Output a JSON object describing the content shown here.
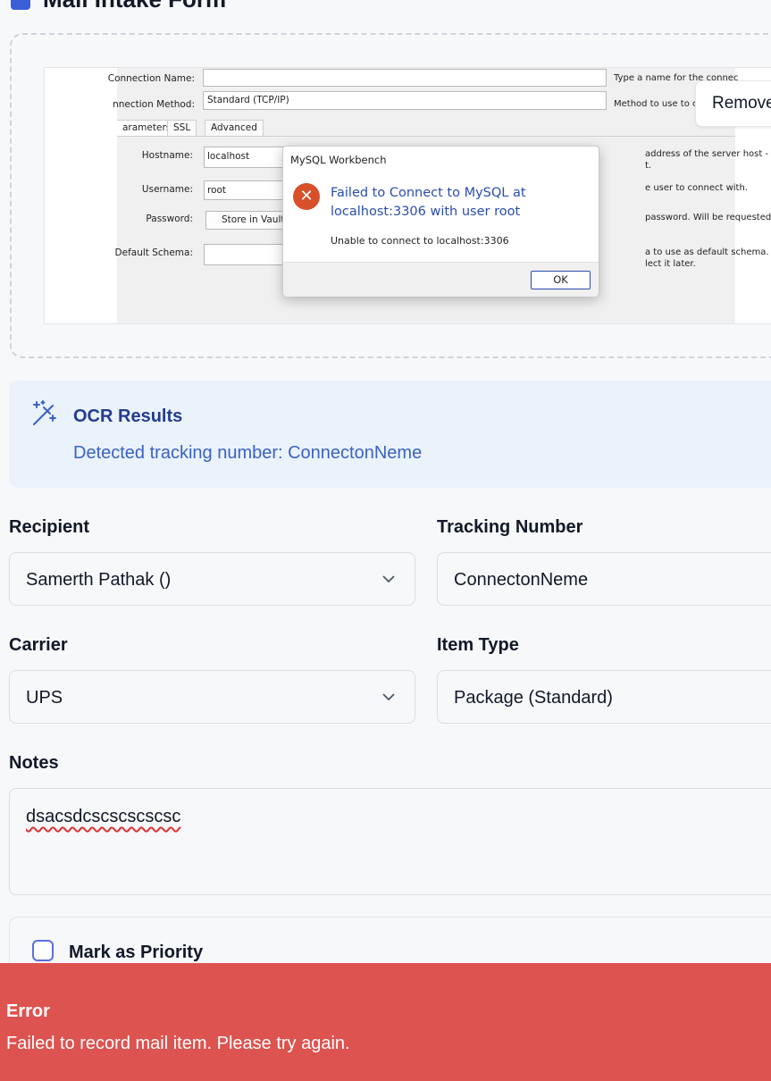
{
  "form": {
    "title": "Mail Intake Form"
  },
  "attachment": {
    "remove_label": "Remove",
    "screenshot": {
      "connection_name_label": "Connection Name:",
      "connection_method_label": "nnection Method:",
      "connection_method_value": "Standard (TCP/IP)",
      "hint_name": "Type a name for the connec",
      "hint_method": "Method to use to conn",
      "tabs": [
        "arameters",
        "SSL",
        "Advanced"
      ],
      "hostname_label": "Hostname:",
      "hostname_value": "localhost",
      "username_label": "Username:",
      "username_value": "root",
      "password_label": "Password:",
      "store_vault_label": "Store in Vault",
      "default_schema_label": "Default Schema:",
      "hint_host_1": "address of the server host - a",
      "hint_host_2": "t.",
      "hint_user": "e user to connect with.",
      "hint_pass": "password. Will be requested la",
      "hint_schema_1": "a to use as default schema. Lea",
      "hint_schema_2": "lect it later.",
      "dialog": {
        "title": "MySQL Workbench",
        "message": "Failed to Connect to MySQL at localhost:3306 with user root",
        "detail": "Unable to connect to localhost:3306",
        "ok_label": "OK"
      }
    }
  },
  "ocr": {
    "heading": "OCR Results",
    "result": "Detected tracking number: ConnectonNeme"
  },
  "fields": {
    "recipient_label": "Recipient",
    "recipient_value": "Samerth Pathak ()",
    "tracking_label": "Tracking Number",
    "tracking_value": "ConnectonNeme",
    "carrier_label": "Carrier",
    "carrier_value": "UPS",
    "item_type_label": "Item Type",
    "item_type_value": "Package (Standard)",
    "notes_label": "Notes",
    "notes_value": "dsacsdcscscscscsc"
  },
  "priority": {
    "label": "Mark as Priority",
    "checked": false
  },
  "toast": {
    "title": "Error",
    "message": "Failed to record mail item. Please try again.",
    "color": "#dd534f"
  },
  "colors": {
    "accent": "#3b5fd9",
    "ocr_bg": "#eaf2fc",
    "error_icon": "#d8502a"
  }
}
